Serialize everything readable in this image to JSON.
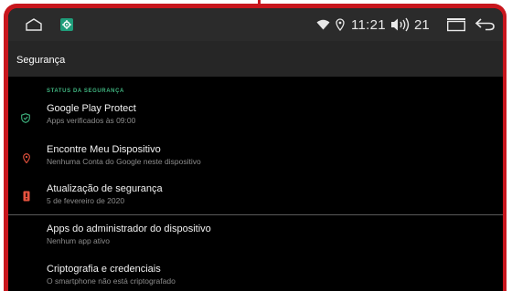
{
  "status_bar": {
    "time": "11:21",
    "volume_level": "21",
    "icons": [
      "home-icon",
      "settings-icon",
      "wifi-icon",
      "location-icon",
      "volume-icon",
      "recents-icon",
      "back-icon"
    ]
  },
  "app_bar": {
    "title": "Segurança"
  },
  "section": {
    "header": "STATUS DA SEGURANÇA"
  },
  "items": [
    {
      "title": "Google Play Protect",
      "subtitle": "Apps verificados às 09:00",
      "icon": "shield-check-icon",
      "icon_color": "#3fb37f"
    },
    {
      "title": "Encontre Meu Dispositivo",
      "subtitle": "Nenhuma Conta do Google neste dispositivo",
      "icon": "location-pin-icon",
      "icon_color": "#e8533f"
    },
    {
      "title": "Atualização de segurança",
      "subtitle": "5 de fevereiro de 2020",
      "icon": "phone-alert-icon",
      "icon_color": "#e8533f"
    },
    {
      "title": "Apps do administrador do dispositivo",
      "subtitle": "Nenhum app ativo"
    },
    {
      "title": "Criptografia e credenciais",
      "subtitle": "O smartphone não está criptografado"
    }
  ],
  "colors": {
    "bezel": "#c8161d",
    "accent": "#3fb37f",
    "warning": "#e8533f",
    "status_bar": "#2b2b2b",
    "app_bar": "#262626"
  }
}
